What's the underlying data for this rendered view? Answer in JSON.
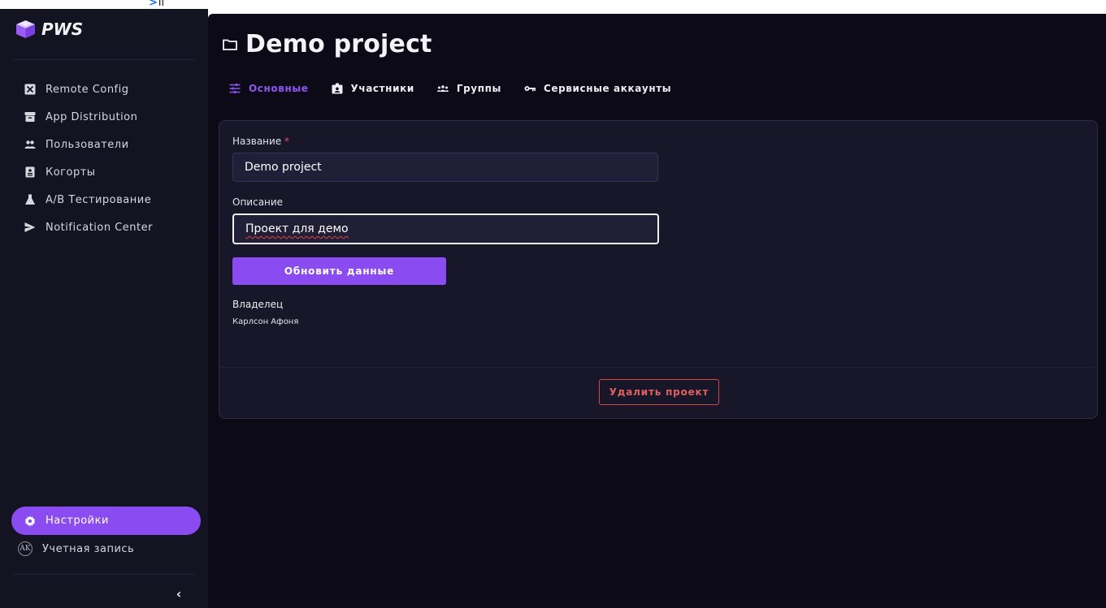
{
  "top_strip": {
    "glyph": ">",
    "suffix": "ll"
  },
  "brand": {
    "name": "PWS"
  },
  "sidebar": {
    "items": [
      {
        "label": "Remote Config",
        "icon": "square-x-icon"
      },
      {
        "label": "App Distribution",
        "icon": "archive-icon"
      },
      {
        "label": "Пользователи",
        "icon": "people-icon"
      },
      {
        "label": "Когорты",
        "icon": "badge-icon"
      },
      {
        "label": "A/B Тестирование",
        "icon": "flask-icon"
      },
      {
        "label": "Notification Center",
        "icon": "send-icon"
      }
    ],
    "settings_label": "Настройки",
    "account_label": "Учетная запись",
    "avatar_initials": "AK",
    "collapse_glyph": "‹"
  },
  "page": {
    "title": "Demo project"
  },
  "tabs": [
    {
      "label": "Основные",
      "icon": "sliders-icon",
      "active": true
    },
    {
      "label": "Участники",
      "icon": "id-badge-icon",
      "active": false
    },
    {
      "label": "Группы",
      "icon": "group-icon",
      "active": false
    },
    {
      "label": "Сервисные аккаунты",
      "icon": "key-icon",
      "active": false
    }
  ],
  "form": {
    "name_label": "Название",
    "required_mark": "*",
    "name_value": "Demo project",
    "description_label": "Описание",
    "description_value": "Проект для демо",
    "update_button": "Обновить данные",
    "owner_label": "Владелец",
    "owner_value": "Карлсон Афоня",
    "delete_button": "Удалить проект"
  },
  "colors": {
    "accent": "#8a4cf0",
    "sidebar_bg": "#141321",
    "main_bg": "#0b0a16",
    "card_bg": "#181729",
    "danger": "#d64545"
  }
}
